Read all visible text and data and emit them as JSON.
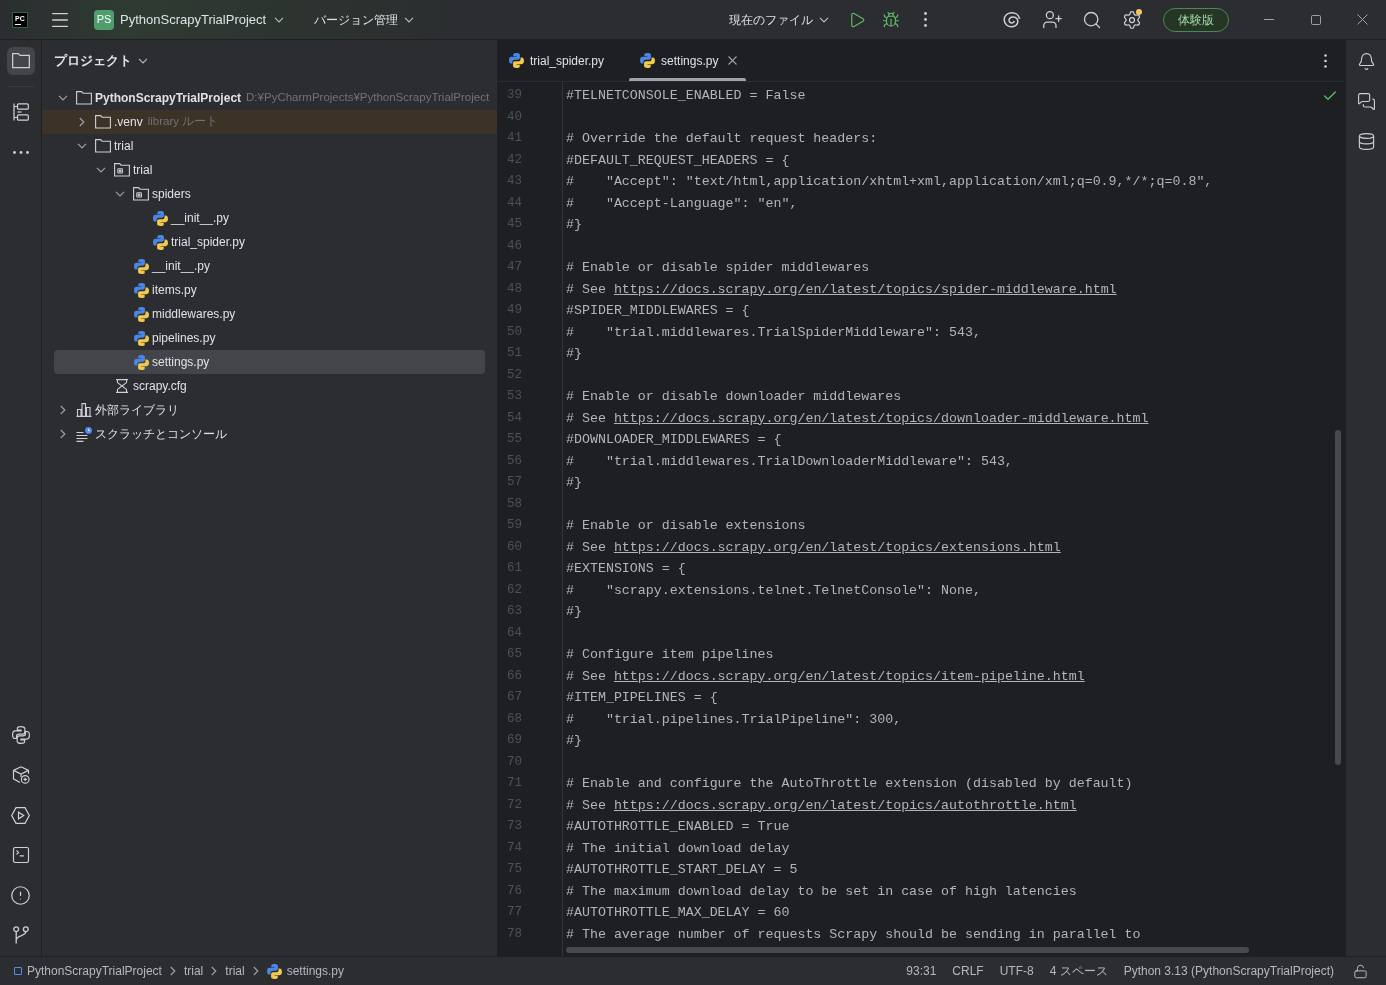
{
  "title_bar": {
    "logo_text": "PC",
    "project_badge": "PS",
    "project_name": "PythonScrapyTrialProject",
    "vcs_menu": "バージョン管理",
    "run_configuration": "現在のファイル",
    "settings_update": true,
    "trial_button": "体験版"
  },
  "tool_windows": {
    "top": [
      {
        "kind": "project",
        "selected": true
      },
      {
        "kind": "structure",
        "selected": false
      },
      {
        "kind": "more",
        "selected": false
      }
    ],
    "bottom": [
      {
        "kind": "python_console",
        "selected": false
      },
      {
        "kind": "python_packages",
        "selected": false
      },
      {
        "kind": "services",
        "selected": false
      },
      {
        "kind": "terminal",
        "selected": false
      },
      {
        "kind": "problems",
        "selected": false
      },
      {
        "kind": "git",
        "selected": false
      }
    ]
  },
  "project_panel": {
    "title": "プロジェクト",
    "tree": [
      {
        "label": "PythonScrapyTrialProject",
        "hint": "D:¥PyCharmProjects¥PythonScrapyTrialProject",
        "kind": "project",
        "expanded": true,
        "selected": false,
        "children": [
          {
            "label": ".venv",
            "hint": "library ルート",
            "kind": "folder",
            "expanded": false,
            "selected": false,
            "color": "#3c3225"
          },
          {
            "label": "trial",
            "kind": "folder",
            "expanded": true,
            "selected": false,
            "children": [
              {
                "label": "trial",
                "kind": "package",
                "expanded": true,
                "selected": false,
                "children": [
                  {
                    "label": "spiders",
                    "kind": "package",
                    "expanded": true,
                    "selected": false,
                    "children": [
                      {
                        "label": "__init__.py",
                        "kind": "python",
                        "selected": false
                      },
                      {
                        "label": "trial_spider.py",
                        "kind": "python",
                        "selected": false
                      }
                    ]
                  },
                  {
                    "label": "__init__.py",
                    "kind": "python",
                    "selected": false
                  },
                  {
                    "label": "items.py",
                    "kind": "python",
                    "selected": false
                  },
                  {
                    "label": "middlewares.py",
                    "kind": "python",
                    "selected": false
                  },
                  {
                    "label": "pipelines.py",
                    "kind": "python",
                    "selected": false
                  },
                  {
                    "label": "settings.py",
                    "kind": "python",
                    "selected": true
                  }
                ]
              },
              {
                "label": "scrapy.cfg",
                "kind": "config",
                "selected": false
              }
            ]
          }
        ]
      },
      {
        "label": "外部ライブラリ",
        "kind": "library",
        "expanded": false,
        "selected": false
      },
      {
        "label": "スクラッチとコンソール",
        "kind": "scratches",
        "expanded": false,
        "selected": false
      }
    ]
  },
  "editor": {
    "tabs": [
      {
        "label": "trial_spider.py",
        "selected": false
      },
      {
        "label": "settings.py",
        "selected": true
      }
    ],
    "lines": [
      {
        "number": "39",
        "text": "#TELNETCONSOLE_ENABLED = False"
      },
      {
        "number": "40"
      },
      {
        "number": "41",
        "text": "# Override the default request headers:"
      },
      {
        "number": "42",
        "text": "#DEFAULT_REQUEST_HEADERS = {"
      },
      {
        "number": "43",
        "text": "#    \"Accept\": \"text/html,application/xhtml+xml,application/xml;q=0.9,*/*;q=0.8\","
      },
      {
        "number": "44",
        "text": "#    \"Accept-Language\": \"en\","
      },
      {
        "number": "45",
        "text": "#}"
      },
      {
        "number": "46"
      },
      {
        "number": "47",
        "text": "# Enable or disable spider middlewares"
      },
      {
        "number": "48",
        "text": "# See ",
        "link": "https://docs.scrapy.org/en/latest/topics/spider-middleware.html"
      },
      {
        "number": "49",
        "text": "#SPIDER_MIDDLEWARES = {"
      },
      {
        "number": "50",
        "text": "#    \"trial.middlewares.TrialSpiderMiddleware\": 543,"
      },
      {
        "number": "51",
        "text": "#}"
      },
      {
        "number": "52"
      },
      {
        "number": "53",
        "text": "# Enable or disable downloader middlewares"
      },
      {
        "number": "54",
        "text": "# See ",
        "link": "https://docs.scrapy.org/en/latest/topics/downloader-middleware.html"
      },
      {
        "number": "55",
        "text": "#DOWNLOADER_MIDDLEWARES = {"
      },
      {
        "number": "56",
        "text": "#    \"trial.middlewares.TrialDownloaderMiddleware\": 543,"
      },
      {
        "number": "57",
        "text": "#}"
      },
      {
        "number": "58"
      },
      {
        "number": "59",
        "text": "# Enable or disable extensions"
      },
      {
        "number": "60",
        "text": "# See ",
        "link": "https://docs.scrapy.org/en/latest/topics/extensions.html"
      },
      {
        "number": "61",
        "text": "#EXTENSIONS = {"
      },
      {
        "number": "62",
        "text": "#    \"scrapy.extensions.telnet.TelnetConsole\": None,"
      },
      {
        "number": "63",
        "text": "#}"
      },
      {
        "number": "64"
      },
      {
        "number": "65",
        "text": "# Configure item pipelines"
      },
      {
        "number": "66",
        "text": "# See ",
        "link": "https://docs.scrapy.org/en/latest/topics/item-pipeline.html"
      },
      {
        "number": "67",
        "text": "#ITEM_PIPELINES = {"
      },
      {
        "number": "68",
        "text": "#    \"trial.pipelines.TrialPipeline\": 300,"
      },
      {
        "number": "69",
        "text": "#}"
      },
      {
        "number": "70"
      },
      {
        "number": "71",
        "text": "# Enable and configure the AutoThrottle extension (disabled by default)"
      },
      {
        "number": "72",
        "text": "# See ",
        "link": "https://docs.scrapy.org/en/latest/topics/autothrottle.html"
      },
      {
        "number": "73",
        "text": "#AUTOTHROTTLE_ENABLED = True"
      },
      {
        "number": "74",
        "text": "# The initial download delay"
      },
      {
        "number": "75",
        "text": "#AUTOTHROTTLE_START_DELAY = 5"
      },
      {
        "number": "76",
        "text": "# The maximum download delay to be set in case of high latencies"
      },
      {
        "number": "77",
        "text": "#AUTOTHROTTLE_MAX_DELAY = 60"
      },
      {
        "number": "78",
        "text": "# The average number of requests Scrapy should be sending in parallel to"
      }
    ]
  },
  "right_tool_windows": [
    {
      "kind": "notifications"
    },
    {
      "kind": "ai_chat"
    },
    {
      "kind": "database"
    }
  ],
  "status_bar": {
    "breadcrumbs": [
      {
        "label": "PythonScrapyTrialProject",
        "kind": "project"
      },
      {
        "label": "trial",
        "kind": "folder"
      },
      {
        "label": "trial",
        "kind": "folder"
      },
      {
        "label": "settings.py",
        "kind": "python"
      }
    ],
    "caret_position": "93:31",
    "line_separator": "CRLF",
    "encoding": "UTF-8",
    "indent": "4 スペース",
    "interpreter": "Python 3.13 (PythonScrapyTrialProject)",
    "read_only": false
  }
}
